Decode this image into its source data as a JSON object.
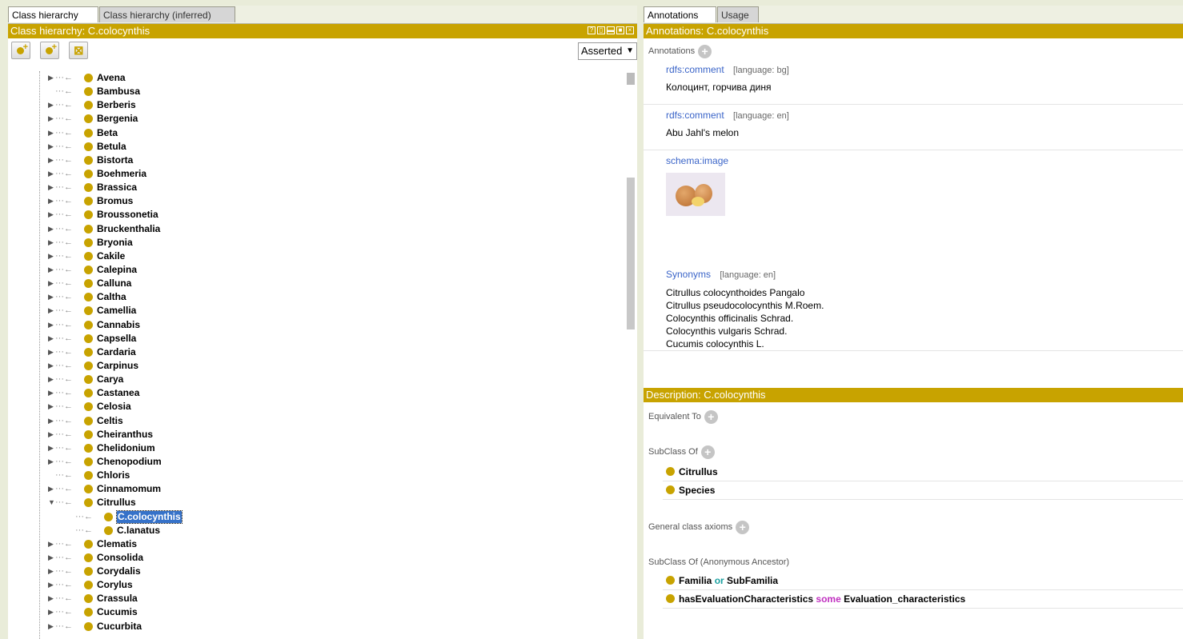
{
  "left": {
    "tabs": [
      "Class hierarchy",
      "Class hierarchy (inferred)"
    ],
    "title": "Class hierarchy: C.colocynthis",
    "asserted_label": "Asserted",
    "toolbar_icons": [
      "add-subclass-icon",
      "add-sibling-icon",
      "delete-class-icon"
    ],
    "tree": [
      {
        "label": "Avena",
        "exp": true,
        "depth": 0
      },
      {
        "label": "Bambusa",
        "exp": false,
        "depth": 0
      },
      {
        "label": "Berberis",
        "exp": true,
        "depth": 0
      },
      {
        "label": "Bergenia",
        "exp": true,
        "depth": 0
      },
      {
        "label": "Beta",
        "exp": true,
        "depth": 0
      },
      {
        "label": "Betula",
        "exp": true,
        "depth": 0
      },
      {
        "label": "Bistorta",
        "exp": true,
        "depth": 0
      },
      {
        "label": "Boehmeria",
        "exp": true,
        "depth": 0
      },
      {
        "label": "Brassica",
        "exp": true,
        "depth": 0
      },
      {
        "label": "Bromus",
        "exp": true,
        "depth": 0
      },
      {
        "label": "Broussonetia",
        "exp": true,
        "depth": 0
      },
      {
        "label": "Bruckenthalia",
        "exp": true,
        "depth": 0
      },
      {
        "label": "Bryonia",
        "exp": true,
        "depth": 0
      },
      {
        "label": "Cakile",
        "exp": true,
        "depth": 0
      },
      {
        "label": "Calepina",
        "exp": true,
        "depth": 0
      },
      {
        "label": "Calluna",
        "exp": true,
        "depth": 0
      },
      {
        "label": "Caltha",
        "exp": true,
        "depth": 0
      },
      {
        "label": "Camellia",
        "exp": true,
        "depth": 0
      },
      {
        "label": "Cannabis",
        "exp": true,
        "depth": 0
      },
      {
        "label": "Capsella",
        "exp": true,
        "depth": 0
      },
      {
        "label": "Cardaria",
        "exp": true,
        "depth": 0
      },
      {
        "label": "Carpinus",
        "exp": true,
        "depth": 0
      },
      {
        "label": "Carya",
        "exp": true,
        "depth": 0
      },
      {
        "label": "Castanea",
        "exp": true,
        "depth": 0
      },
      {
        "label": "Celosia",
        "exp": true,
        "depth": 0
      },
      {
        "label": "Celtis",
        "exp": true,
        "depth": 0
      },
      {
        "label": "Cheiranthus",
        "exp": true,
        "depth": 0
      },
      {
        "label": "Chelidonium",
        "exp": true,
        "depth": 0
      },
      {
        "label": "Chenopodium",
        "exp": true,
        "depth": 0
      },
      {
        "label": "Chloris",
        "exp": false,
        "depth": 0
      },
      {
        "label": "Cinnamomum",
        "exp": true,
        "depth": 0
      },
      {
        "label": "Citrullus",
        "exp": "open",
        "depth": 0
      },
      {
        "label": "C.colocynthis",
        "exp": false,
        "depth": 1,
        "selected": true
      },
      {
        "label": "C.lanatus",
        "exp": false,
        "depth": 1
      },
      {
        "label": "Clematis",
        "exp": true,
        "depth": 0
      },
      {
        "label": "Consolida",
        "exp": true,
        "depth": 0
      },
      {
        "label": "Corydalis",
        "exp": true,
        "depth": 0
      },
      {
        "label": "Corylus",
        "exp": true,
        "depth": 0
      },
      {
        "label": "Crassula",
        "exp": true,
        "depth": 0
      },
      {
        "label": "Cucumis",
        "exp": true,
        "depth": 0
      },
      {
        "label": "Cucurbita",
        "exp": true,
        "depth": 0
      }
    ]
  },
  "right": {
    "tabs": [
      "Annotations",
      "Usage"
    ],
    "title": "Annotations: C.colocynthis",
    "annotations_header": "Annotations",
    "annotations": [
      {
        "prop": "rdfs:comment",
        "lang": "[language: bg]",
        "value": "Колоцинт, горчива диня"
      },
      {
        "prop": "rdfs:comment",
        "lang": "[language: en]",
        "value": "Abu Jahl's melon"
      }
    ],
    "image_prop": "schema:image",
    "synonyms": {
      "prop": "Synonyms",
      "lang": "[language: en]",
      "values": [
        "Citrullus colocynthoides Pangalo",
        "Citrullus pseudocolocynthis M.Roem.",
        "Colocynthis officinalis Schrad.",
        "Colocynthis vulgaris Schrad.",
        "Cucumis colocynthis L."
      ]
    },
    "description_title": "Description: C.colocynthis",
    "equivalent_to": "Equivalent To",
    "subclass_of": "SubClass Of",
    "subclass_items": [
      "Citrullus",
      "Species"
    ],
    "general_axioms": "General class axioms",
    "anon_ancestor": "SubClass Of (Anonymous Ancestor)",
    "anon": {
      "a1": "Familia",
      "or": "or",
      "a2": "SubFamilia",
      "b1": "hasEvaluationCharacteristics",
      "some": "some",
      "b2": "Evaluation_characteristics"
    }
  },
  "colors": {
    "gold": "#c8a300",
    "selection": "#3672c9",
    "link": "#3a64c8"
  }
}
